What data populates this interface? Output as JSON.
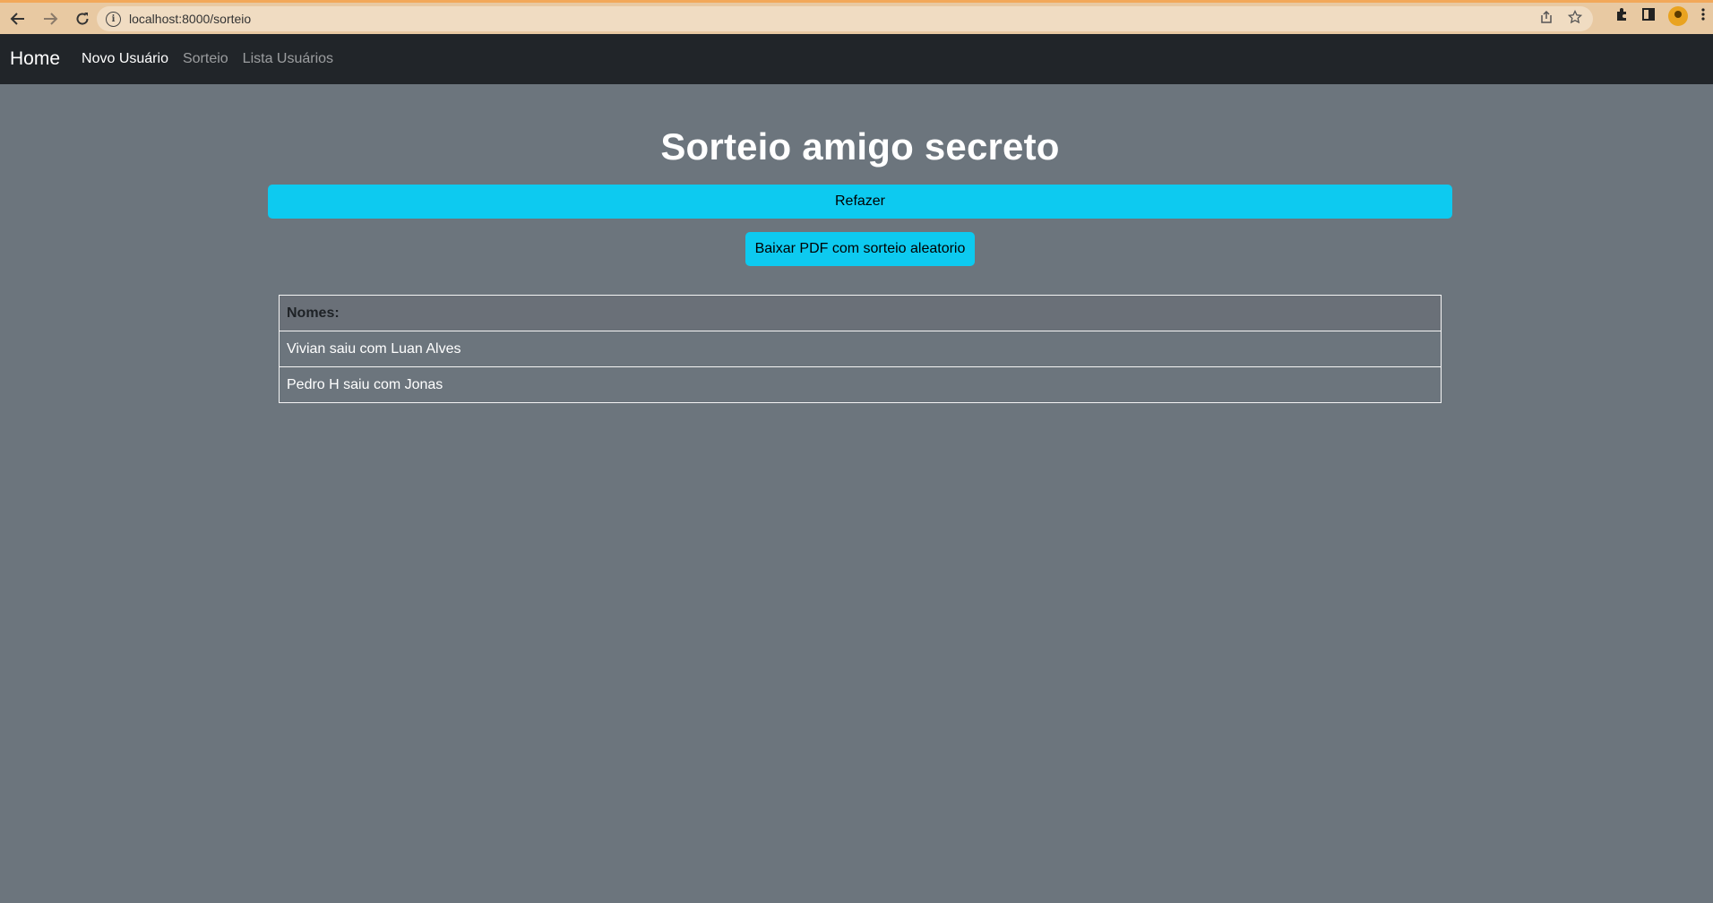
{
  "browser": {
    "url": "localhost:8000/sorteio",
    "back_icon": "arrow-left-icon",
    "forward_icon": "arrow-right-icon",
    "reload_icon": "reload-icon"
  },
  "navbar": {
    "brand": "Home",
    "links": [
      {
        "label": "Novo Usuário",
        "active": true
      },
      {
        "label": "Sorteio",
        "active": false
      },
      {
        "label": "Lista Usuários",
        "active": false
      }
    ]
  },
  "main": {
    "title": "Sorteio amigo secreto",
    "refazer_label": "Refazer",
    "pdf_label": "Baixar PDF com sorteio aleatorio",
    "table": {
      "header": "Nomes:",
      "rows": [
        "Vivian saiu com Luan Alves",
        "Pedro H saiu com Jonas"
      ]
    }
  },
  "colors": {
    "page_bg": "#6c757d",
    "navbar_bg": "#212529",
    "button_info": "#0dcaf0"
  }
}
